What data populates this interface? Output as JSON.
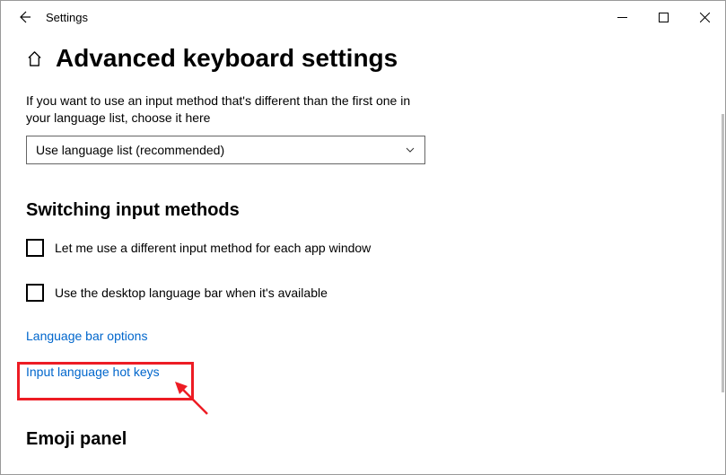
{
  "window": {
    "title": "Settings"
  },
  "page": {
    "heading": "Advanced keyboard settings",
    "description": "If you want to use an input method that's different than the first one in your language list, choose it here",
    "dropdown_value": "Use language list (recommended)"
  },
  "section_switching": {
    "heading": "Switching input methods",
    "checkbox1_label": "Let me use a different input method for each app window",
    "checkbox2_label": "Use the desktop language bar when it's available",
    "link1": "Language bar options",
    "link2": "Input language hot keys"
  },
  "section_emoji": {
    "heading": "Emoji panel"
  }
}
